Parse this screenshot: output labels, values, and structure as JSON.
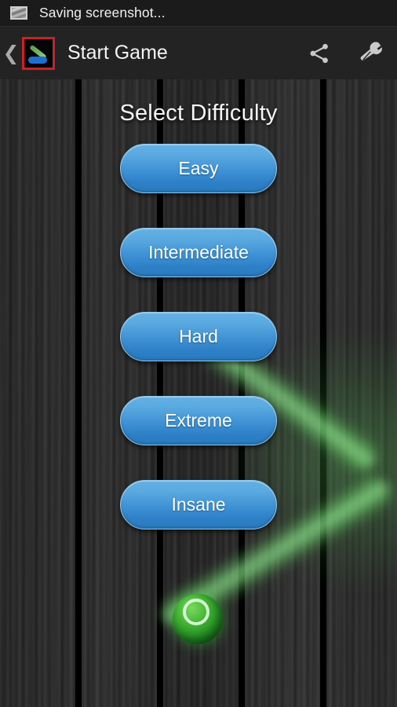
{
  "status_bar": {
    "icon": "screenshot-image-icon",
    "text": "Saving screenshot..."
  },
  "action_bar": {
    "back_icon": "back-chevron-icon",
    "app_icon": "hockey-stick-puck-app-icon",
    "title": "Start Game",
    "actions": [
      {
        "icon": "share-icon",
        "label": "Share"
      },
      {
        "icon": "wrench-settings-icon",
        "label": "Settings"
      }
    ]
  },
  "main": {
    "title": "Select Difficulty",
    "difficulties": [
      {
        "label": "Easy"
      },
      {
        "label": "Intermediate"
      },
      {
        "label": "Hard"
      },
      {
        "label": "Extreme"
      },
      {
        "label": "Insane"
      }
    ]
  },
  "colors": {
    "button_blue_top": "#63b0e4",
    "button_blue_bottom": "#2a7cc2",
    "button_border": "#8ec7ea",
    "action_bar_bg": "#232323",
    "status_bar_bg": "#1b1b1b",
    "wood_dark": "#2a2a2a",
    "trail_green": "#6ee16e",
    "ball_green": "#41b334",
    "app_icon_highlight": "#cc1f28"
  }
}
